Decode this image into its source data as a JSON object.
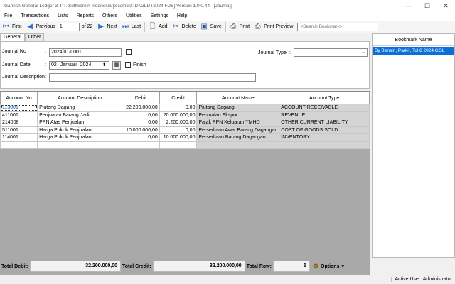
{
  "window": {
    "title": "Ganesh General Ledger 3: PT. Softwarein Indonesia [localhost: D:\\GLDT2024.FDB] Version 1.0.0.44 - [Journal]",
    "controls": {
      "minimize": "—",
      "maximize": "☐",
      "close": "✕"
    }
  },
  "menu": [
    "File",
    "Transactions",
    "Lists",
    "Reports",
    "Others",
    "Utilities",
    "Settings",
    "Help"
  ],
  "toolbar": {
    "first": "First",
    "previous": "Previous",
    "page": "1",
    "of_pages": "of 22",
    "next": "Next",
    "last": "Last",
    "add": "Add",
    "delete": "Delete",
    "save": "Save",
    "print": "Print",
    "print_preview": "Print Preview",
    "search_placeholder": "<Search Bookmark>"
  },
  "tabs": [
    "General",
    "Other"
  ],
  "form": {
    "journal_no_label": "Journal No",
    "journal_no": "2024/01/0001",
    "journal_date_label": "Journal Date",
    "date_day": "02",
    "date_month": "Januari",
    "date_year": "2024",
    "finish_label": "Finish",
    "description_label": "Journal Description",
    "description": "",
    "journal_type_label": "Journal Type",
    "journal_type": "",
    "colon": ":"
  },
  "grid": {
    "headers": [
      "Account No",
      "Account Description",
      "Debit",
      "Credit",
      "Account Name",
      "Account Type"
    ],
    "rows": [
      [
        "113001",
        "Piutang Dagang",
        "22.200.000,00",
        "0,00",
        "Piutang Dagang",
        "ACCOUNT RECEIVABLE"
      ],
      [
        "411001",
        "Penjualan Barang Jadi",
        "0,00",
        "20.000.000,00",
        "Penjualan Ekspor",
        "REVENUE"
      ],
      [
        "214008",
        "PPN Atas Penjualan",
        "0,00",
        "2.200.000,00",
        "Pajak PPN Keluaran YMHD",
        "OTHER CURRENT LIABILITY"
      ],
      [
        "511001",
        "Harga Pokok Penjualan",
        "10.000.000,00",
        "0,00",
        "Persediaan Awal Barang Dagangan",
        "COST OF GOODS SOLD"
      ],
      [
        "114001",
        "Harga Pokok Penjualan",
        "0,00",
        "10.000.000,00",
        "Persediaan Barang Dagangan",
        "INVENTORY"
      ]
    ]
  },
  "bookmark": {
    "header": "Bookmark Name",
    "items": [
      "By Bensin, Parkir, Tol 8 2024 GGL"
    ]
  },
  "totals": {
    "debit_label": "Total Debit:",
    "debit": "32.200.000,00",
    "credit_label": "Total Credit:",
    "credit": "32.200.000,00",
    "row_label": "Total Row:",
    "rows": "5",
    "options": "Options"
  },
  "status": {
    "active_user": "Active User: Administrator"
  }
}
